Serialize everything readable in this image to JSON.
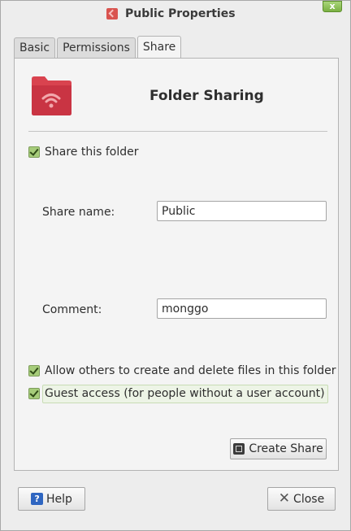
{
  "window": {
    "title": "Public Properties"
  },
  "tabs": [
    {
      "label": "Basic"
    },
    {
      "label": "Permissions"
    },
    {
      "label": "Share"
    }
  ],
  "share": {
    "section_title": "Folder Sharing",
    "share_folder": {
      "label": "Share this folder",
      "checked": true
    },
    "share_name": {
      "label": "Share name:",
      "value": "Public"
    },
    "comment": {
      "label": "Comment:",
      "value": "monggo"
    },
    "allow_others": {
      "label": "Allow others to create and delete files in this folder",
      "checked": true
    },
    "guest_access": {
      "label": "Guest access (for people without a user account)",
      "checked": true
    },
    "create_button": {
      "label": "Create Share",
      "icon": "create-share-icon"
    }
  },
  "footer": {
    "help_label": "Help",
    "close_label": "Close"
  },
  "colors": {
    "folder": "#d9434f",
    "check_bg": "#a6cc7a",
    "help_icon": "#2f66c1"
  }
}
